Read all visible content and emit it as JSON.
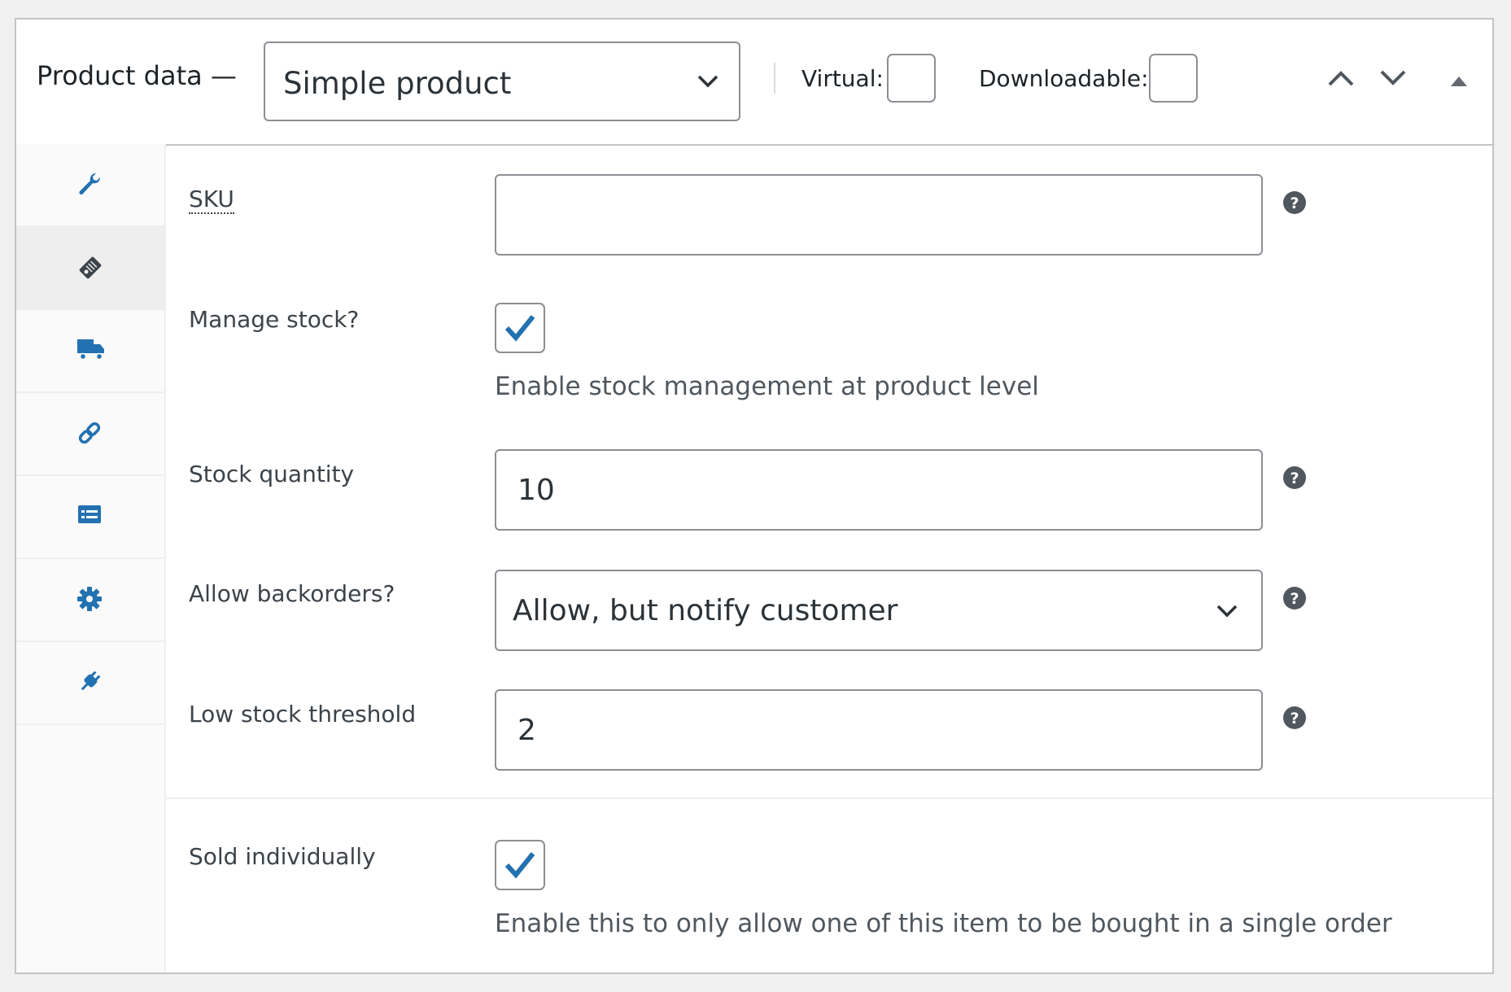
{
  "header": {
    "title": "Product data —",
    "product_type": "Simple product",
    "virtual_label": "Virtual:",
    "downloadable_label": "Downloadable:"
  },
  "tabs": [
    {
      "name": "general",
      "icon": "wrench-icon",
      "active": false
    },
    {
      "name": "inventory",
      "icon": "tag-icon",
      "active": true
    },
    {
      "name": "shipping",
      "icon": "truck-icon",
      "active": false
    },
    {
      "name": "linked-products",
      "icon": "link-icon",
      "active": false
    },
    {
      "name": "attributes",
      "icon": "list-icon",
      "active": false
    },
    {
      "name": "advanced",
      "icon": "gear-icon",
      "active": false
    },
    {
      "name": "plugin",
      "icon": "plug-icon",
      "active": false
    }
  ],
  "fields": {
    "sku_label": "SKU",
    "sku_value": "",
    "manage_stock_label": "Manage stock?",
    "manage_stock_checked": true,
    "manage_stock_desc": "Enable stock management at product level",
    "stock_quantity_label": "Stock quantity",
    "stock_quantity_value": "10",
    "backorders_label": "Allow backorders?",
    "backorders_value": "Allow, but notify customer",
    "low_stock_label": "Low stock threshold",
    "low_stock_value": "2",
    "sold_individually_label": "Sold individually",
    "sold_individually_checked": true,
    "sold_individually_desc": "Enable this to only allow one of this item to be bought in a single order"
  },
  "colors": {
    "accent": "#2271b1",
    "border": "#8c8f94",
    "help_icon": "#50575e"
  }
}
